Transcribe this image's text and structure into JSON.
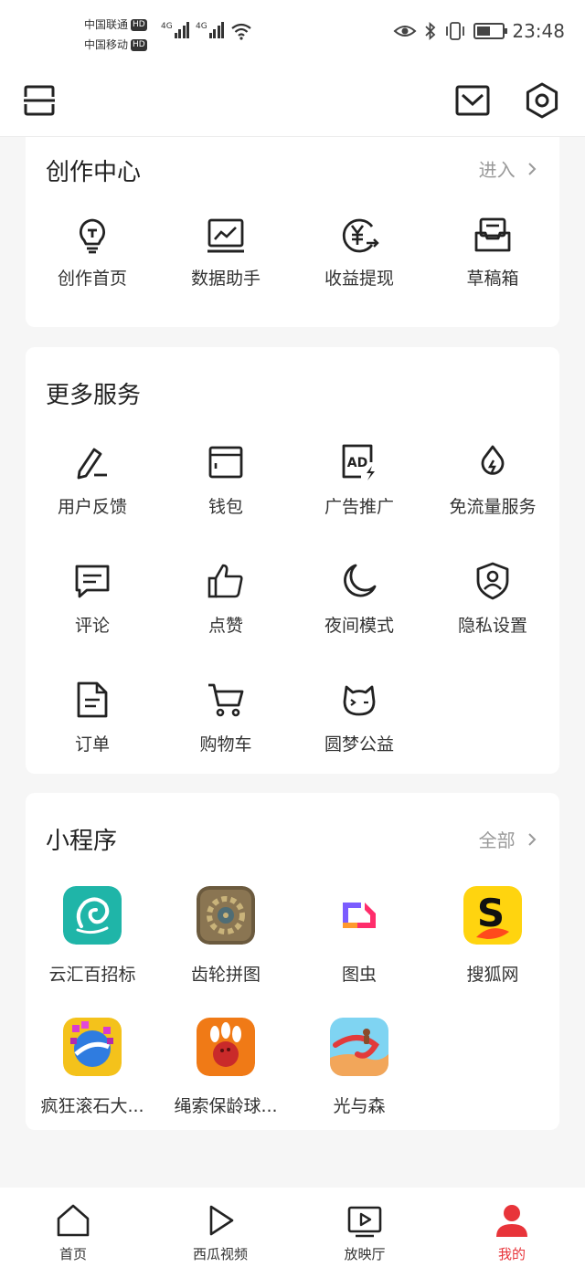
{
  "status_bar": {
    "carrier1": "中国联通",
    "carrier2": "中国移动",
    "hd": "HD",
    "network1": "4G",
    "network2": "4G",
    "time": "23:48"
  },
  "creation_center": {
    "title": "创作中心",
    "link": "进入",
    "items": [
      {
        "label": "创作首页",
        "icon": "lightbulb-icon"
      },
      {
        "label": "数据助手",
        "icon": "chart-monitor-icon"
      },
      {
        "label": "收益提现",
        "icon": "yuan-withdraw-icon"
      },
      {
        "label": "草稿箱",
        "icon": "drafts-box-icon"
      }
    ]
  },
  "more_services": {
    "title": "更多服务",
    "items": [
      {
        "label": "用户反馈",
        "icon": "pen-icon"
      },
      {
        "label": "钱包",
        "icon": "wallet-icon"
      },
      {
        "label": "广告推广",
        "icon": "ad-icon"
      },
      {
        "label": "免流量服务",
        "icon": "drop-icon"
      },
      {
        "label": "评论",
        "icon": "comment-icon"
      },
      {
        "label": "点赞",
        "icon": "thumbs-up-icon"
      },
      {
        "label": "夜间模式",
        "icon": "moon-icon"
      },
      {
        "label": "隐私设置",
        "icon": "privacy-shield-icon"
      },
      {
        "label": "订单",
        "icon": "order-document-icon"
      },
      {
        "label": "购物车",
        "icon": "shopping-cart-icon"
      },
      {
        "label": "圆梦公益",
        "icon": "cat-face-icon"
      }
    ]
  },
  "mini_programs": {
    "title": "小程序",
    "link": "全部",
    "items": [
      {
        "label": "云汇百招标"
      },
      {
        "label": "齿轮拼图"
      },
      {
        "label": "图虫"
      },
      {
        "label": "搜狐网"
      },
      {
        "label": "疯狂滚石大..."
      },
      {
        "label": "绳索保龄球..."
      },
      {
        "label": "光与森"
      }
    ]
  },
  "bottom_nav": {
    "items": [
      {
        "label": "首页",
        "icon": "home-icon"
      },
      {
        "label": "西瓜视频",
        "icon": "play-icon"
      },
      {
        "label": "放映厅",
        "icon": "tv-play-icon"
      },
      {
        "label": "我的",
        "icon": "person-icon"
      }
    ],
    "active_color": "#e8343a"
  }
}
